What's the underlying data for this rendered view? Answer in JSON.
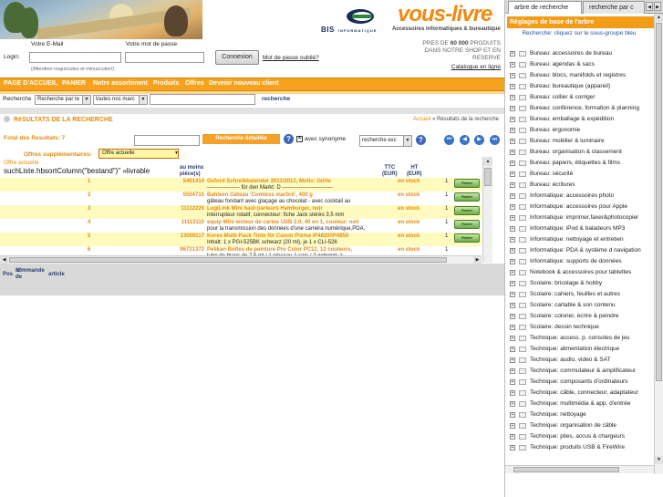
{
  "brand": {
    "bis_label": "BIS",
    "bis_sub": "INFORMATIQUE",
    "logo_text": "vous-livre",
    "logo_sub": "Accessoires informatiques & bureautique"
  },
  "login": {
    "email_label": "Votre E-Mail",
    "password_label": "Votre mot de passe:",
    "login_label": "Login:",
    "note": "(Attention majuscules et minuscules!)",
    "connect_button": "Connexion",
    "forgot_link": "Mot de passe oublié?",
    "promo_line1": "PRES DE",
    "promo_count": "60 000",
    "promo_line1b": "PRODUITS",
    "promo_line2": "DANS NOTRE SHOP ET EN",
    "promo_line3": "RESERVE",
    "catalog_link": "Catalogue en ligne"
  },
  "nav": {
    "items": [
      "PAGE D'ACCUEIL",
      "PANIER",
      "Notre assortiment",
      "Produits",
      "Offres",
      "Devenir nouveau client"
    ]
  },
  "search": {
    "label": "Recherche",
    "select1": "Recherche par te",
    "select2": "toutes nos marc",
    "button": "recherche"
  },
  "results": {
    "title": "RéSULTATS DE LA RECHERCHE",
    "breadcrumb_home": "Accueil",
    "breadcrumb_current": "» Résultats de la recherche",
    "count_label": "Fotal des Resultats: 7",
    "detail_button": "Recherche détaillée",
    "synonym_label": "avec synonyme",
    "sort_select": "recherche exc",
    "offers_label": "Offres supplémentaires:",
    "offers_value": "Offre actuelle",
    "current_offer": "Offre actuelle",
    "code_line": "suchListe.hbsortColumn(\"bestand\")\" »livrable"
  },
  "table": {
    "col_qty_min": "au moins",
    "col_qty_unit": "pièce(s)",
    "col_ttc": "TTC",
    "col_ttc_unit": "(EUR)",
    "col_ht": "HT",
    "col_ht_unit": "(EUR)",
    "cart_label": "Panier",
    "rows": [
      {
        "n": "1",
        "code": "5401414",
        "title": "Oxford Schreibkalender 2011/2012, Motiv: Girlie",
        "desc": "------------------ für den Markt: D ----------------------------",
        "stock": "en stock",
        "qty": "1"
      },
      {
        "n": "2",
        "code": "5504710",
        "title": "Bahlsen Gâteau 'Comtess marbré', 400 g",
        "desc": "gâteau fondant avec glaçage au chocolat - avec cocktail au",
        "stock": "en stock",
        "qty": "1"
      },
      {
        "n": "3",
        "code": "11112220",
        "title": "LogiLink Mini haut-parleurs Hamburger, noir",
        "desc": "interrupteur rotatif, connecteur: fiche Jack stéréo 3,5 mm",
        "stock": "en stock",
        "qty": "1"
      },
      {
        "n": "4",
        "code": "11113110",
        "title": "equip Mini lecteur de cartes USB 2.0, 40 en 1, couleur: noir",
        "desc": "pour la transmission des données d'une caméra numérique,PDA,",
        "stock": "en stock",
        "qty": "1"
      },
      {
        "n": "5",
        "code": "13009117",
        "title": "Kores Multi-Pack Tinte für Canon Pixma iP4820/iP4850",
        "desc": "Inhalt: 1 x PGI-525BK schwarz (20 ml), je 1 x CLI-526",
        "stock": "en stock",
        "qty": "1"
      },
      {
        "n": "6",
        "code": "96721373",
        "title": "Pelikan Boîtes de peinture Pro Color PC12, 12 couleurs,",
        "desc": "tube de blanc de 7,5 ml / 1 pinceau à soie / 2 gobelets à",
        "stock": "en stock",
        "qty": "1"
      }
    ],
    "pos_label": "Pos",
    "order_no_label": "N° de",
    "order_no_label2": "commande",
    "article_label": "article"
  },
  "right_panel": {
    "tab1": "arbre de recherche",
    "tab2": "recherche par c",
    "tree_title": "Réglages de base de l'arbre",
    "tree_hint": "Recherche: cliquez sur le sous-groupe bleu",
    "items": [
      "Bureau: accessoires de bureau",
      "Bureau: agendas & sacs",
      "Bureau: blocs, manifolds et registres",
      "Bureau: bureautique (appareil)",
      "Bureau: collier & corriger",
      "Bureau: conférence, formation & planning",
      "Bureau: emballage & expédition",
      "Bureau: ergonomie",
      "Bureau: mobilier & luminaire",
      "Bureau: organisation & classement",
      "Bureau: papiers, étiquettes & films",
      "Bureau: sécurité",
      "Bureau: écritures",
      "Informatique: accessoires photo",
      "Informatique: accessoires pour Apple",
      "Informatique: imprimer,faxer&photocopier",
      "Informatique: iPod & baladeurs MP3",
      "Informatique: nettoyage et entretien",
      "Informatique: PDA & système d navigation",
      "Informatique: supports de données",
      "Notebook & accessoires pour tablettes",
      "Scolaire: bricolage & hobby",
      "Scolaire: cahiers, feuilles et autres",
      "Scolaire: cartable & son contenu",
      "Scolaire: colorier, écrire & peindre",
      "Scolaire: dessin technique",
      "Technique: access. p. consoles de jeu",
      "Technique: alimentation électrique",
      "Technique: audio, vidéo & SAT",
      "Technique: commutateur & amplificateur",
      "Technique: composants d'ordinateurs",
      "Technique: câble, connecteur, adaptateur",
      "Technique: multimédia & app. d'entrée",
      "Technique: nettoyage",
      "Technique: organisation de câble",
      "Technique: piles, accus & chargeurs",
      "Technique: produits USB & FireWire"
    ]
  },
  "colors": {
    "accent": "#f6a21c",
    "accent_text": "#e48b0c",
    "link_blue": "#2550a0"
  }
}
